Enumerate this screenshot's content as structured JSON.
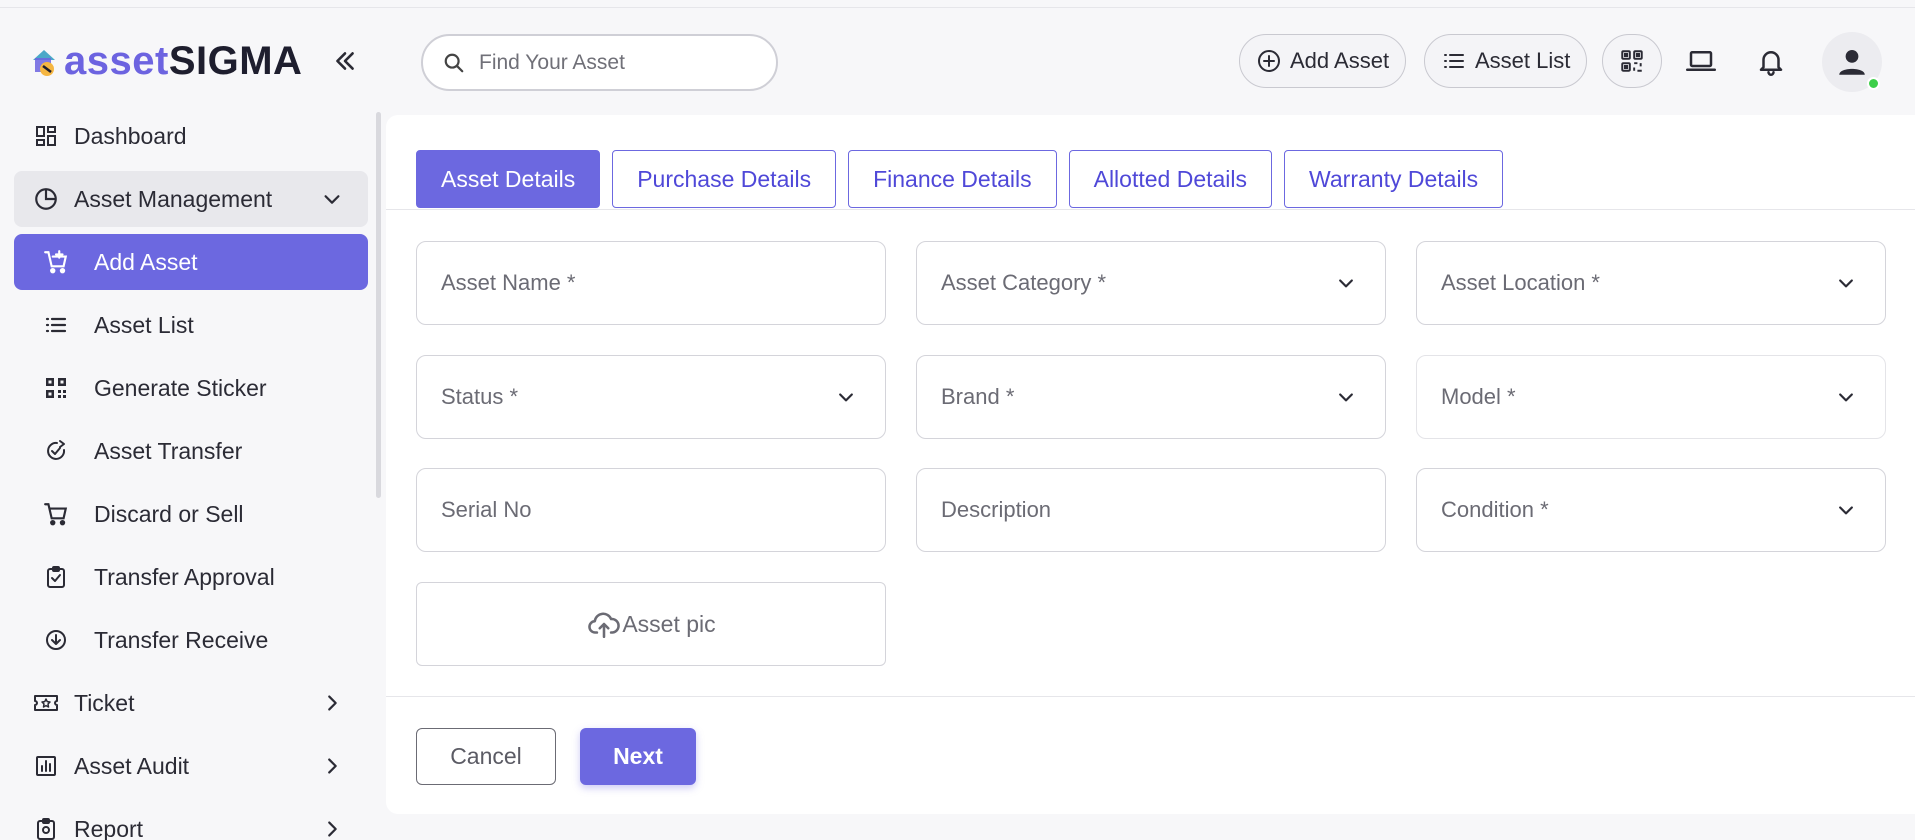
{
  "brand": {
    "part1": "asset",
    "part2": "SIGMA"
  },
  "colors": {
    "accent": "#6c68e0",
    "online": "#3ecf4a"
  },
  "sidebar": {
    "items": [
      {
        "label": "Dashboard",
        "icon": "dashboard-icon"
      },
      {
        "label": "Asset Management",
        "icon": "pie-chart-icon",
        "expanded": true
      },
      {
        "label": "Add Asset",
        "icon": "cart-plus-icon",
        "active": true
      },
      {
        "label": "Asset List",
        "icon": "list-icon"
      },
      {
        "label": "Generate Sticker",
        "icon": "qr-code-icon"
      },
      {
        "label": "Asset Transfer",
        "icon": "transfer-icon"
      },
      {
        "label": "Discard or Sell",
        "icon": "cart-icon"
      },
      {
        "label": "Transfer Approval",
        "icon": "clipboard-check-icon"
      },
      {
        "label": "Transfer Receive",
        "icon": "download-circle-icon"
      },
      {
        "label": "Ticket",
        "icon": "ticket-icon"
      },
      {
        "label": "Asset Audit",
        "icon": "audit-chart-icon"
      },
      {
        "label": "Report",
        "icon": "report-icon"
      }
    ]
  },
  "header": {
    "search_placeholder": "Find Your Asset",
    "add_asset": "Add Asset",
    "asset_list": "Asset List"
  },
  "tabs": [
    "Asset Details",
    "Purchase Details",
    "Finance Details",
    "Allotted Details",
    "Warranty Details"
  ],
  "form": {
    "asset_name": "Asset Name *",
    "asset_category": "Asset Category *",
    "asset_location": "Asset Location *",
    "status": "Status *",
    "brand": "Brand *",
    "model": "Model *",
    "serial_no": "Serial No",
    "description": "Description",
    "condition": "Condition *",
    "asset_pic": "Asset pic"
  },
  "actions": {
    "cancel": "Cancel",
    "next": "Next"
  }
}
